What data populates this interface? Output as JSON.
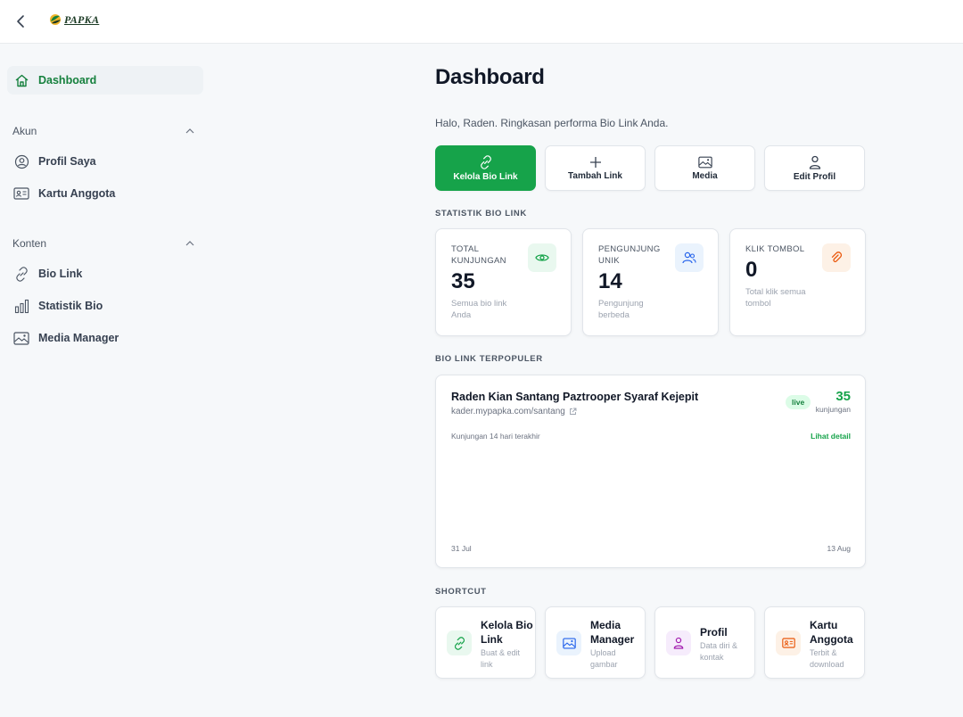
{
  "header": {
    "logo_text": "PAPKA",
    "back_icon": "chevron-left-icon"
  },
  "sidebar": {
    "dashboard": {
      "label": "Dashboard",
      "icon": "home-icon"
    },
    "sections": [
      {
        "title": "Akun",
        "items": [
          {
            "label": "Profil Saya",
            "icon": "user-circle-icon"
          },
          {
            "label": "Kartu Anggota",
            "icon": "id-card-icon"
          }
        ]
      },
      {
        "title": "Konten",
        "items": [
          {
            "label": "Bio Link",
            "icon": "link-icon"
          },
          {
            "label": "Statistik Bio",
            "icon": "bar-chart-icon"
          },
          {
            "label": "Media Manager",
            "icon": "image-icon"
          }
        ]
      }
    ]
  },
  "main": {
    "title": "Dashboard",
    "greeting": "Halo, Raden. Ringkasan performa Bio Link Anda.",
    "actions": [
      {
        "label": "Kelola Bio Link",
        "icon": "link-icon"
      },
      {
        "label": "Tambah Link",
        "icon": "plus-icon"
      },
      {
        "label": "Media",
        "icon": "image-icon"
      },
      {
        "label": "Edit Profil",
        "icon": "user-icon"
      }
    ],
    "stats_label": "STATISTIK BIO LINK",
    "stats": [
      {
        "title": "TOTAL KUNJUNGAN",
        "value": "35",
        "sub": "Semua bio link Anda",
        "icon": "eye-icon"
      },
      {
        "title": "PENGUNJUNG UNIK",
        "value": "14",
        "sub": "Pengunjung berbeda",
        "icon": "users-icon"
      },
      {
        "title": "KLIK TOMBOL",
        "value": "0",
        "sub": "Total klik semua tombol",
        "icon": "paperclip-icon"
      }
    ],
    "popular_label": "BIO LINK TERPOPULER",
    "popular": {
      "title": "Raden Kian Santang Paztrooper Syaraf Kejepit",
      "url": "kader.mypapka.com/santang",
      "badge": "live",
      "count": "35",
      "count_label": "kunjungan",
      "range_label": "Kunjungan 14 hari terakhir",
      "detail_link": "Lihat detail",
      "axis_start": "31 Jul",
      "axis_end": "13 Aug"
    },
    "shortcut_label": "SHORTCUT",
    "shortcuts": [
      {
        "title": "Kelola Bio Link",
        "sub": "Buat & edit link",
        "icon": "link-icon"
      },
      {
        "title": "Media Manager",
        "sub": "Upload gambar",
        "icon": "image-icon"
      },
      {
        "title": "Profil",
        "sub": "Data diri & kontak",
        "icon": "user-icon"
      },
      {
        "title": "Kartu Anggota",
        "sub": "Terbit & download",
        "icon": "id-card-icon"
      }
    ]
  },
  "colors": {
    "accent": "#16a34a",
    "accent_dark": "#15803d",
    "background": "#f6f8fa"
  }
}
